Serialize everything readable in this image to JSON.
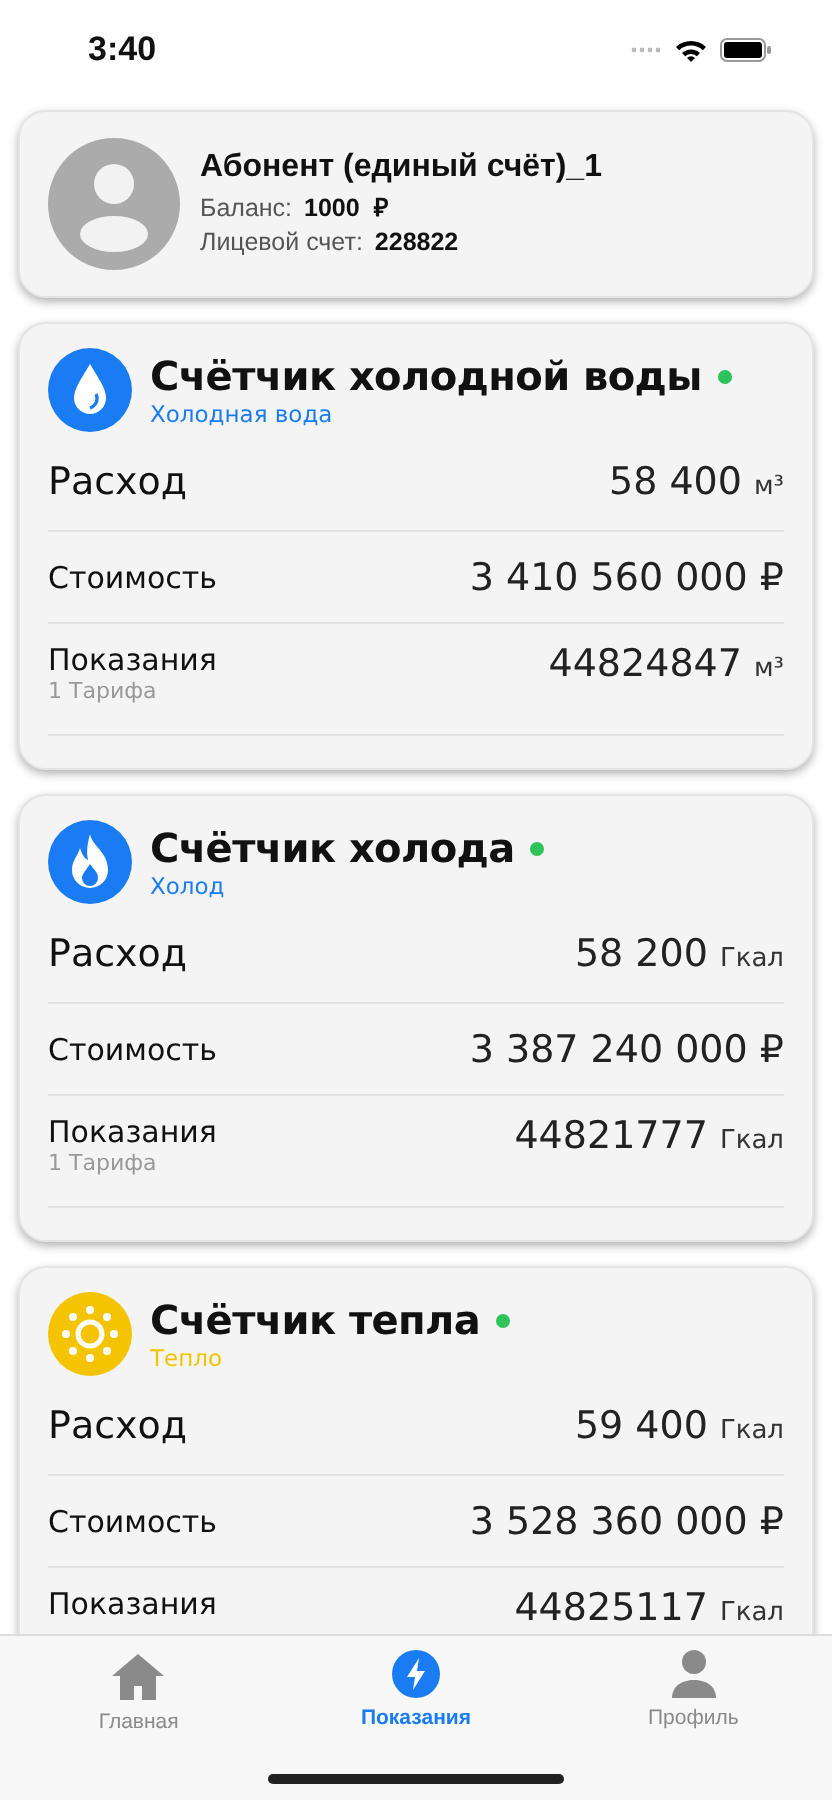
{
  "status_bar": {
    "time": "3:40"
  },
  "account": {
    "name": "Абонент (единый счёт)_1",
    "balance_label": "Баланс:",
    "balance": "1000  ₽",
    "account_label": "Лицевой счет:",
    "account_number": "228822"
  },
  "meters": [
    {
      "kind": "water",
      "color": "#1a7cf2",
      "title": "Счётчик холодной воды",
      "online": true,
      "subtitle": "Холодная вода",
      "rows": [
        {
          "kind": "large",
          "label": "Расход",
          "value": "58 400",
          "unit": "м³"
        },
        {
          "kind": "normal",
          "label": "Стоимость",
          "value": "3 410 560 000 ₽"
        },
        {
          "kind": "normal",
          "label": "Показания",
          "note": "1 Тарифа",
          "value": "44824847",
          "unit": "м³"
        }
      ]
    },
    {
      "kind": "flame",
      "color": "#1a7cf2",
      "title": "Счётчик холода",
      "online": true,
      "subtitle": "Холод",
      "rows": [
        {
          "kind": "large",
          "label": "Расход",
          "value": "58 200",
          "unit": "Гкал"
        },
        {
          "kind": "normal",
          "label": "Стоимость",
          "value": "3 387 240 000 ₽"
        },
        {
          "kind": "normal",
          "label": "Показания",
          "note": "1 Тарифа",
          "value": "44821777",
          "unit": "Гкал"
        }
      ]
    },
    {
      "kind": "sun",
      "color": "#f5c400",
      "title": "Счётчик тепла",
      "online": true,
      "subtitle": "Тепло",
      "rows": [
        {
          "kind": "large",
          "label": "Расход",
          "value": "59 400",
          "unit": "Гкал"
        },
        {
          "kind": "normal",
          "label": "Стоимость",
          "value": "3 528 360 000 ₽"
        },
        {
          "kind": "normal",
          "label": "Показания",
          "value": "44825117",
          "unit": "Гкал"
        }
      ]
    }
  ],
  "tab_bar": [
    {
      "kind": "home",
      "label": "Главная",
      "selected": false
    },
    {
      "kind": "bolt",
      "label": "Показания",
      "selected": true
    },
    {
      "kind": "person",
      "label": "Профиль",
      "selected": false
    }
  ]
}
